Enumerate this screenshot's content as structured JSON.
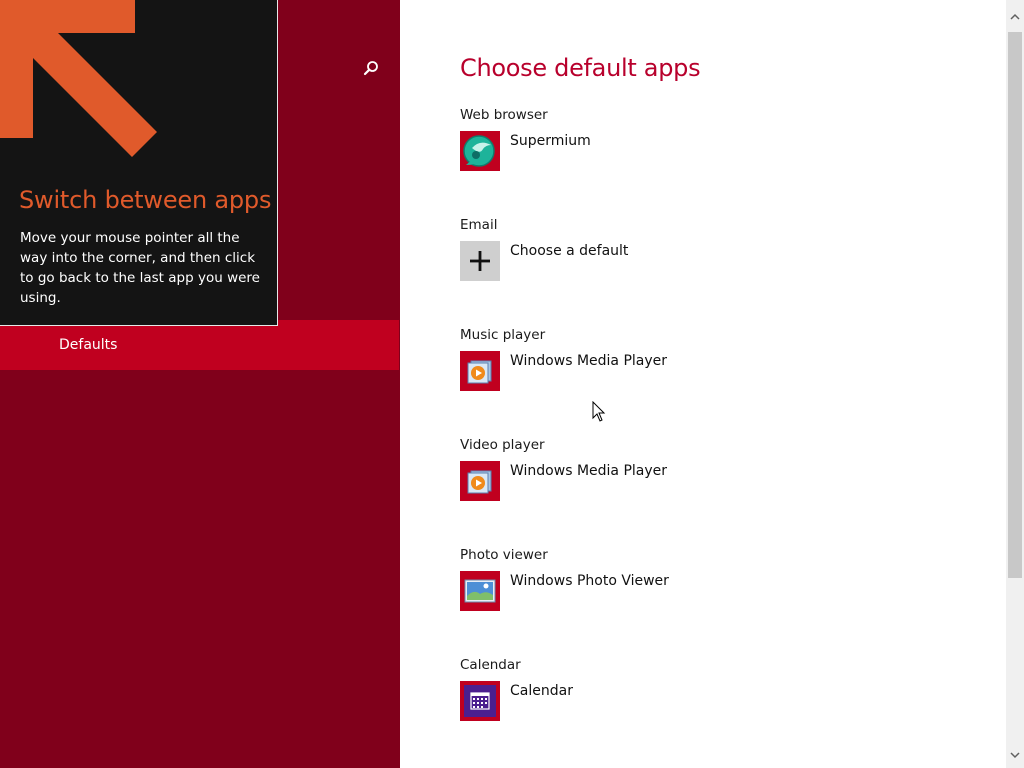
{
  "tip": {
    "title": "Switch between apps",
    "body": "Move your mouse pointer all the way into the corner, and then click to go back to the last app you were using."
  },
  "nav": {
    "search_icon": "search-icon",
    "selected_item": "Defaults"
  },
  "main": {
    "title": "Choose default apps",
    "categories": [
      {
        "label": "Web browser",
        "app": "Supermium",
        "icon": "supermium-icon"
      },
      {
        "label": "Email",
        "app": "Choose a default",
        "icon": "plus-icon"
      },
      {
        "label": "Music player",
        "app": "Windows Media Player",
        "icon": "media-player-icon"
      },
      {
        "label": "Video player",
        "app": "Windows Media Player",
        "icon": "media-player-icon"
      },
      {
        "label": "Photo viewer",
        "app": "Windows Photo Viewer",
        "icon": "photo-viewer-icon"
      },
      {
        "label": "Calendar",
        "app": "Calendar",
        "icon": "calendar-icon"
      }
    ]
  },
  "colors": {
    "left_pane_bg": "#80001b",
    "selected_item_bg": "#c0001f",
    "accent_title": "#b8002c",
    "tip_title": "#e05a2b",
    "tip_bg": "#141414",
    "icon_tile_bg": "#c0001f",
    "calendar_tile_bg": "#4b1f8f"
  }
}
